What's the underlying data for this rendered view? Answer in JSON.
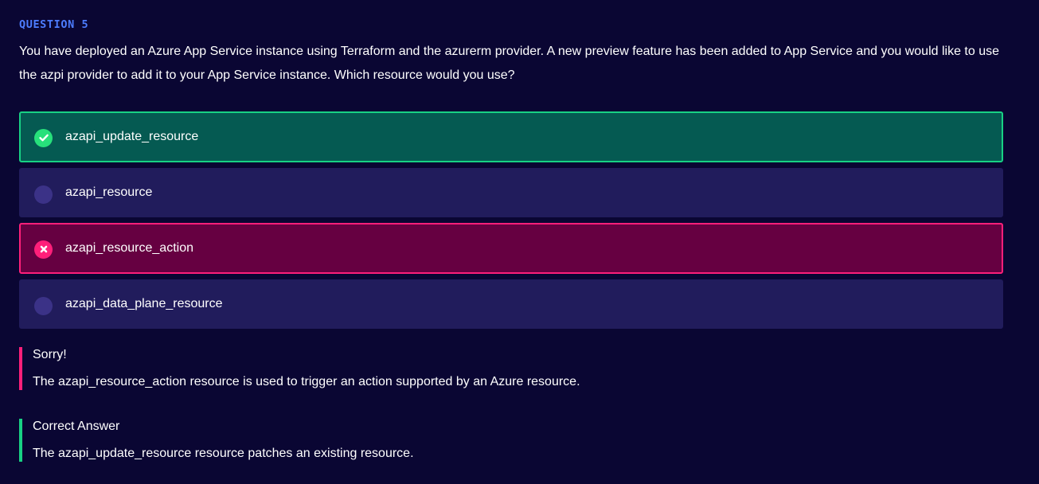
{
  "question": {
    "label": "QUESTION 5",
    "text": "You have deployed an Azure App Service instance using Terraform and the azurerm provider. A new preview feature has been added to App Service and you would like to use the azpi provider to add it to your App Service instance. Which resource would you use?"
  },
  "options": [
    {
      "label": "azapi_update_resource",
      "state": "correct"
    },
    {
      "label": "azapi_resource",
      "state": "unselected"
    },
    {
      "label": "azapi_resource_action",
      "state": "incorrect"
    },
    {
      "label": "azapi_data_plane_resource",
      "state": "unselected"
    }
  ],
  "feedback": {
    "sorry_title": "Sorry!",
    "sorry_text": "The azapi_resource_action resource is used to trigger an action supported by an Azure resource.",
    "correct_title": "Correct Answer",
    "correct_text": "The azapi_update_resource resource patches an existing resource."
  },
  "colors": {
    "background": "#0a0633",
    "question_label": "#4d7dff",
    "correct": "#18d184",
    "incorrect": "#ff1f7a",
    "option_bg": "#211c5c"
  }
}
